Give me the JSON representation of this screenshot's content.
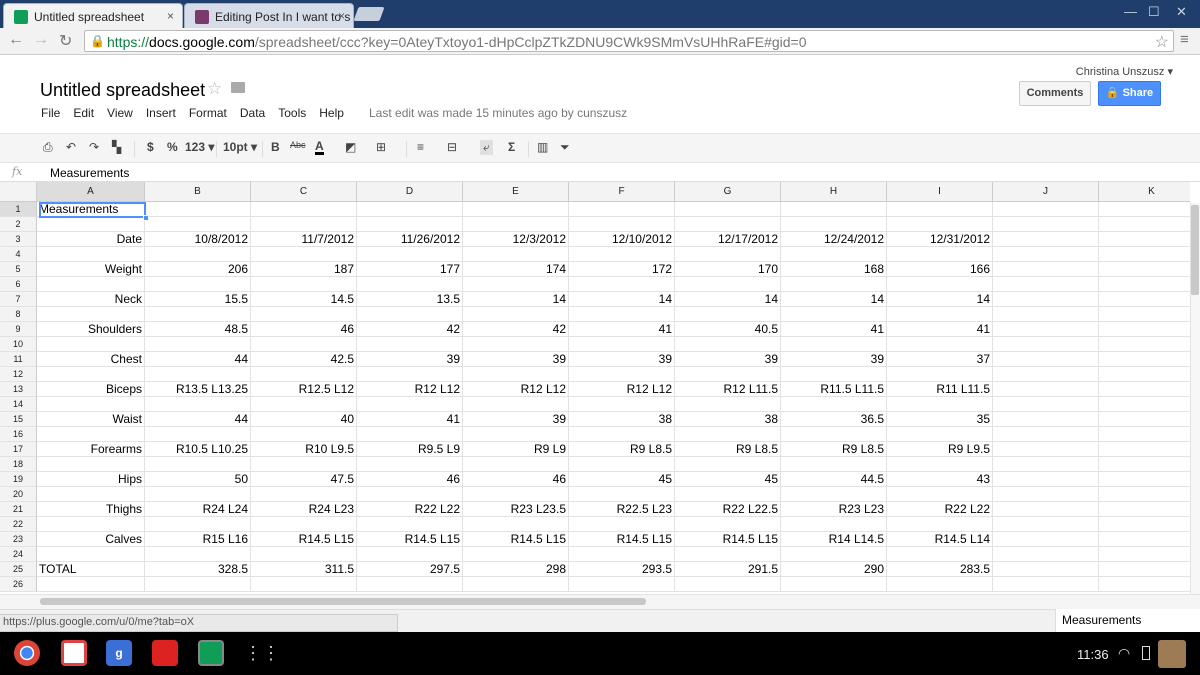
{
  "browser": {
    "tabs": [
      {
        "title": "Untitled spreadsheet",
        "close": "×"
      },
      {
        "title": "Editing Post In I want to s",
        "close": "×"
      }
    ],
    "window_controls": {
      "min": "—",
      "max": "☐",
      "close": "✕"
    },
    "url_scheme": "https://",
    "url_host": "docs.google.com",
    "url_path": "/spreadsheet/ccc?key=0AteyTxtoyo1-dHpCclpZTkZDNU9CWk9SMmVsUHhRaFE#gid=0",
    "status_url": "https://plus.google.com/u/0/me?tab=oX"
  },
  "doc": {
    "title": "Untitled spreadsheet",
    "user": "Christina Unszusz ▾",
    "last_edit": "Last edit was made 15 minutes ago by cunszusz",
    "comments_label": "Comments",
    "share_label": "Share"
  },
  "menu": [
    "File",
    "Edit",
    "View",
    "Insert",
    "Format",
    "Data",
    "Tools",
    "Help"
  ],
  "format_toolbar": {
    "currency": "$",
    "percent": "%",
    "number_format": "123 ▾",
    "font_size": "10pt ▾",
    "bold": "B",
    "strike": "Abc",
    "text_color": "A",
    "sum": "Σ"
  },
  "formula_bar": {
    "label": "fx",
    "content": "Measurements"
  },
  "columns": [
    "A",
    "B",
    "C",
    "D",
    "E",
    "F",
    "G",
    "H",
    "I",
    "J",
    "K"
  ],
  "rows": [
    [
      "Measurements",
      "",
      "",
      "",
      "",
      "",
      "",
      "",
      ""
    ],
    [
      "",
      "",
      "",
      "",
      "",
      "",
      "",
      "",
      ""
    ],
    [
      "Date",
      "10/8/2012",
      "11/7/2012",
      "11/26/2012",
      "12/3/2012",
      "12/10/2012",
      "12/17/2012",
      "12/24/2012",
      "12/31/2012"
    ],
    [
      "",
      "",
      "",
      "",
      "",
      "",
      "",
      "",
      ""
    ],
    [
      "Weight",
      "206",
      "187",
      "177",
      "174",
      "172",
      "170",
      "168",
      "166"
    ],
    [
      "",
      "",
      "",
      "",
      "",
      "",
      "",
      "",
      ""
    ],
    [
      "Neck",
      "15.5",
      "14.5",
      "13.5",
      "14",
      "14",
      "14",
      "14",
      "14"
    ],
    [
      "",
      "",
      "",
      "",
      "",
      "",
      "",
      "",
      ""
    ],
    [
      "Shoulders",
      "48.5",
      "46",
      "42",
      "42",
      "41",
      "40.5",
      "41",
      "41"
    ],
    [
      "",
      "",
      "",
      "",
      "",
      "",
      "",
      "",
      ""
    ],
    [
      "Chest",
      "44",
      "42.5",
      "39",
      "39",
      "39",
      "39",
      "39",
      "37"
    ],
    [
      "",
      "",
      "",
      "",
      "",
      "",
      "",
      "",
      ""
    ],
    [
      "Biceps",
      "R13.5 L13.25",
      "R12.5 L12",
      "R12 L12",
      "R12 L12",
      "R12 L12",
      "R12 L11.5",
      "R11.5 L11.5",
      "R11 L11.5"
    ],
    [
      "",
      "",
      "",
      "",
      "",
      "",
      "",
      "",
      ""
    ],
    [
      "Waist",
      "44",
      "40",
      "41",
      "39",
      "38",
      "38",
      "36.5",
      "35"
    ],
    [
      "",
      "",
      "",
      "",
      "",
      "",
      "",
      "",
      ""
    ],
    [
      "Forearms",
      "R10.5 L10.25",
      "R10 L9.5",
      "R9.5 L9",
      "R9 L9",
      "R9 L8.5",
      "R9 L8.5",
      "R9 L8.5",
      "R9 L9.5"
    ],
    [
      "",
      "",
      "",
      "",
      "",
      "",
      "",
      "",
      ""
    ],
    [
      "Hips",
      "50",
      "47.5",
      "46",
      "46",
      "45",
      "45",
      "44.5",
      "43"
    ],
    [
      "",
      "",
      "",
      "",
      "",
      "",
      "",
      "",
      ""
    ],
    [
      "Thighs",
      "R24 L24",
      "R24 L23",
      "R22 L22",
      "R23 L23.5",
      "R22.5 L23",
      "R22 L22.5",
      "R23 L23",
      "R22 L22"
    ],
    [
      "",
      "",
      "",
      "",
      "",
      "",
      "",
      "",
      ""
    ],
    [
      "Calves",
      "R15 L16",
      "R14.5 L15",
      "R14.5 L15",
      "R14.5 L15",
      "R14.5 L15",
      "R14.5 L15",
      "R14 L14.5",
      "R14.5 L14"
    ],
    [
      "",
      "",
      "",
      "",
      "",
      "",
      "",
      "",
      ""
    ],
    [
      "TOTAL",
      "328.5",
      "311.5",
      "297.5",
      "298",
      "293.5",
      "291.5",
      "290",
      "283.5"
    ],
    [
      "",
      "",
      "",
      "",
      "",
      "",
      "",
      "",
      ""
    ]
  ],
  "sheet_tab": "Measurements",
  "shelf": {
    "clock": "11:36"
  },
  "colors": {
    "tabbar": "#1f3e6b",
    "share": "#4d90fe",
    "selection": "#4d90fe"
  }
}
